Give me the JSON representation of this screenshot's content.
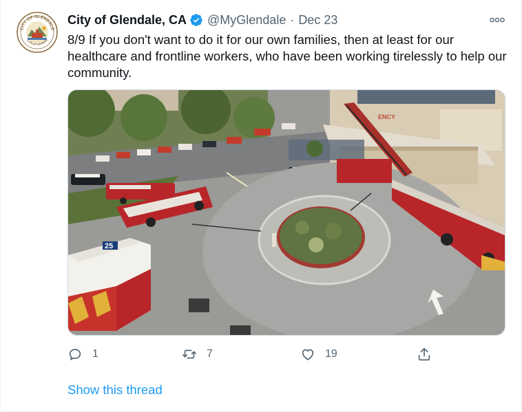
{
  "tweet": {
    "author_name": "City of Glendale, CA",
    "handle": "@MyGlendale",
    "separator": "·",
    "date": "Dec 23",
    "text": "8/9 If you don't want to do it for our own families, then at least for our healthcare and frontline workers, who have been working tirelessly to help our community.",
    "avatar": {
      "seal_top": "CITY OF GLENDALE",
      "seal_bottom": "CALIFORNIA"
    },
    "media": {
      "vehicle_number": "25",
      "sign_text": "ENCY"
    }
  },
  "actions": {
    "reply_count": "1",
    "retweet_count": "7",
    "like_count": "19"
  },
  "links": {
    "show_thread": "Show this thread"
  },
  "colors": {
    "accent": "#1d9bf0",
    "verified": "#1d9bf0",
    "muted": "#536471"
  },
  "icons": [
    "verified-badge-icon",
    "more-options-icon",
    "reply-icon",
    "retweet-icon",
    "like-icon",
    "share-icon"
  ]
}
